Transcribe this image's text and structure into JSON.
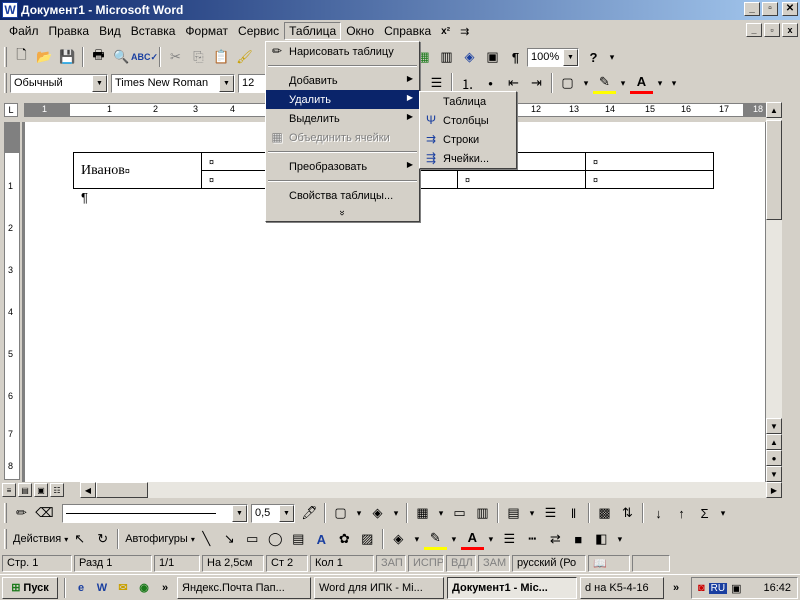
{
  "window": {
    "title": "Документ1 - Microsoft Word",
    "app_icon": "W",
    "buttons": {
      "minimize": "_",
      "maximize": "▫",
      "close": "✕"
    }
  },
  "menubar": {
    "items": [
      "Файл",
      "Правка",
      "Вид",
      "Вставка",
      "Формат",
      "Сервис",
      "Таблица",
      "Окно",
      "Справка"
    ],
    "help_glyph": "x²",
    "doc_controls": {
      "minimize": "_",
      "restore": "▫",
      "close": "x"
    }
  },
  "toolbar_standard": {
    "zoom": "100%"
  },
  "toolbar_formatting": {
    "style": "Обычный",
    "font": "Times New Roman",
    "size": "12"
  },
  "ruler": {
    "labels": [
      "1",
      "1",
      "2",
      "3",
      "4",
      "12",
      "13",
      "14",
      "15",
      "16",
      "17",
      "18"
    ]
  },
  "vruler": {
    "labels": [
      "1",
      "2",
      "3",
      "4",
      "5",
      "6",
      "7",
      "8"
    ]
  },
  "document": {
    "first_cell": "Иванов",
    "cell_mark": "¤",
    "pilcrow": "¶"
  },
  "table_menu": {
    "items": [
      {
        "label": "Нарисовать таблицу",
        "icon": "pencil-icon",
        "enabled": true
      },
      {
        "label": "Добавить",
        "submenu": true,
        "enabled": true
      },
      {
        "label": "Удалить",
        "submenu": true,
        "enabled": true,
        "highlighted": true
      },
      {
        "label": "Выделить",
        "submenu": true,
        "enabled": true
      },
      {
        "label": "Объединить ячейки",
        "icon": "merge-cells-icon",
        "enabled": false
      },
      {
        "label": "Преобразовать",
        "submenu": true,
        "enabled": true
      },
      {
        "label": "Свойства таблицы...",
        "enabled": true
      }
    ],
    "expand": "»"
  },
  "delete_submenu": {
    "items": [
      {
        "label": "Таблица",
        "icon": "table-delete-icon"
      },
      {
        "label": "Столбцы",
        "icon": "columns-delete-icon"
      },
      {
        "label": "Строки",
        "icon": "rows-delete-icon"
      },
      {
        "label": "Ячейки...",
        "icon": "cells-delete-icon"
      }
    ]
  },
  "drawing_toolbar": {
    "line_width": "0,5",
    "actions": "Действия",
    "autoshapes": "Автофигуры",
    "sum": "Σ"
  },
  "statusbar": {
    "page": "Стр. 1",
    "section": "Разд 1",
    "pages": "1/1",
    "at": "На 2,5см",
    "line": "Ст 2",
    "col": "Кол 1",
    "rec": "ЗАП",
    "trk": "ИСПР",
    "ext": "ВДЛ",
    "ovr": "ЗАМ",
    "lang": "русский (Ро"
  },
  "taskbar": {
    "start": "Пуск",
    "tasks": [
      "Яндекс.Почта Пап...",
      "Word для  ИПК - Mi...",
      "Документ1 - Mic...",
      "d на K5-4-16"
    ],
    "lang": "RU",
    "time": "16:42"
  }
}
